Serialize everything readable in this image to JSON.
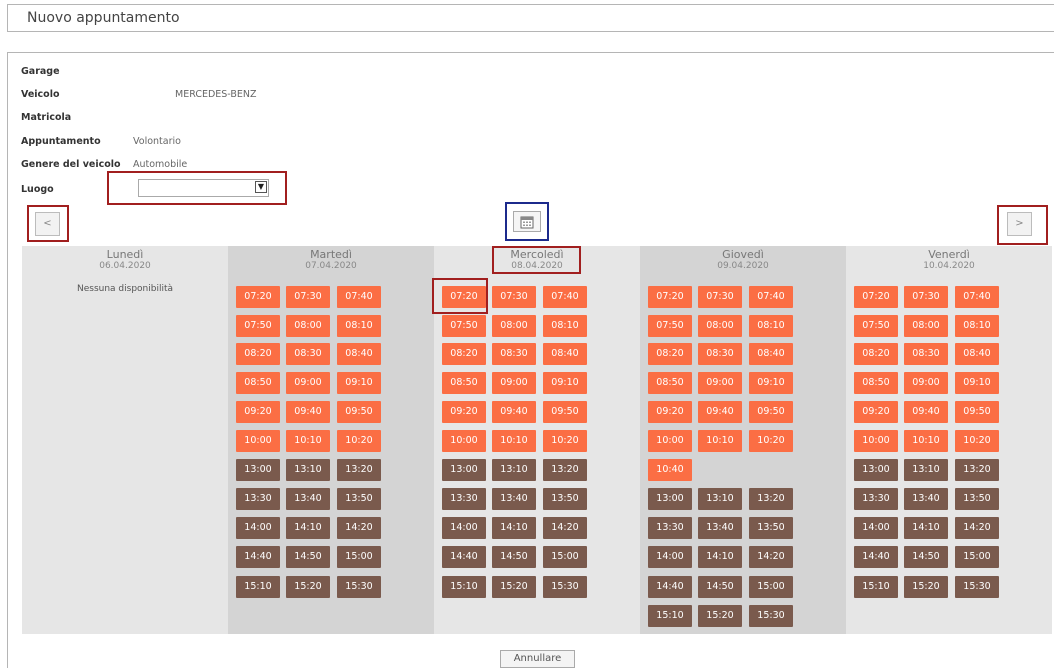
{
  "title": "Nuovo appuntamento",
  "form": {
    "garage_label": "Garage",
    "veicolo_label": "Veicolo",
    "veicolo_value": "MERCEDES-BENZ",
    "matricola_label": "Matricola",
    "appuntamento_label": "Appuntamento",
    "appuntamento_value": "Volontario",
    "genere_label": "Genere del veicolo",
    "genere_value": "Automobile",
    "luogo_label": "Luogo",
    "luogo_value": ""
  },
  "nav": {
    "prev": "<",
    "next": ">",
    "calendar_icon": "calendar-icon"
  },
  "colors": {
    "available": "#fb6e44",
    "available_alt": "#7a5a4d",
    "highlight_red": "#a11f1f",
    "highlight_blue": "#1c2a8c"
  },
  "days": [
    {
      "name": "Lunedì",
      "date": "06.04.2020",
      "no_availability": "Nessuna disponibilità",
      "rows": []
    },
    {
      "name": "Martedì",
      "date": "07.04.2020",
      "rows": [
        {
          "t": [
            "07:20",
            "07:30",
            "07:40"
          ],
          "c": "o"
        },
        {
          "t": [
            "07:50",
            "08:00",
            "08:10"
          ],
          "c": "o"
        },
        {
          "t": [
            "08:20",
            "08:30",
            "08:40"
          ],
          "c": "o"
        },
        {
          "t": [
            "08:50",
            "09:00",
            "09:10"
          ],
          "c": "o"
        },
        {
          "t": [
            "09:20",
            "09:40",
            "09:50"
          ],
          "c": "o"
        },
        {
          "t": [
            "10:00",
            "10:10",
            "10:20"
          ],
          "c": "o"
        },
        {
          "t": [
            "13:00",
            "13:10",
            "13:20"
          ],
          "c": "b"
        },
        {
          "t": [
            "13:30",
            "13:40",
            "13:50"
          ],
          "c": "b"
        },
        {
          "t": [
            "14:00",
            "14:10",
            "14:20"
          ],
          "c": "b"
        },
        {
          "t": [
            "14:40",
            "14:50",
            "15:00"
          ],
          "c": "b"
        },
        {
          "t": [
            "15:10",
            "15:20",
            "15:30"
          ],
          "c": "b"
        }
      ]
    },
    {
      "name": "Mercoledì",
      "date": "08.04.2020",
      "rows": [
        {
          "t": [
            "07:20",
            "07:30",
            "07:40"
          ],
          "c": "o"
        },
        {
          "t": [
            "07:50",
            "08:00",
            "08:10"
          ],
          "c": "o"
        },
        {
          "t": [
            "08:20",
            "08:30",
            "08:40"
          ],
          "c": "o"
        },
        {
          "t": [
            "08:50",
            "09:00",
            "09:10"
          ],
          "c": "o"
        },
        {
          "t": [
            "09:20",
            "09:40",
            "09:50"
          ],
          "c": "o"
        },
        {
          "t": [
            "10:00",
            "10:10",
            "10:20"
          ],
          "c": "o"
        },
        {
          "t": [
            "13:00",
            "13:10",
            "13:20"
          ],
          "c": "b"
        },
        {
          "t": [
            "13:30",
            "13:40",
            "13:50"
          ],
          "c": "b"
        },
        {
          "t": [
            "14:00",
            "14:10",
            "14:20"
          ],
          "c": "b"
        },
        {
          "t": [
            "14:40",
            "14:50",
            "15:00"
          ],
          "c": "b"
        },
        {
          "t": [
            "15:10",
            "15:20",
            "15:30"
          ],
          "c": "b"
        }
      ]
    },
    {
      "name": "Giovedì",
      "date": "09.04.2020",
      "rows": [
        {
          "t": [
            "07:20",
            "07:30",
            "07:40"
          ],
          "c": "o"
        },
        {
          "t": [
            "07:50",
            "08:00",
            "08:10"
          ],
          "c": "o"
        },
        {
          "t": [
            "08:20",
            "08:30",
            "08:40"
          ],
          "c": "o"
        },
        {
          "t": [
            "08:50",
            "09:00",
            "09:10"
          ],
          "c": "o"
        },
        {
          "t": [
            "09:20",
            "09:40",
            "09:50"
          ],
          "c": "o"
        },
        {
          "t": [
            "10:00",
            "10:10",
            "10:20"
          ],
          "c": "o"
        },
        {
          "t": [
            "10:40"
          ],
          "c": "o"
        },
        {
          "t": [
            "13:00",
            "13:10",
            "13:20"
          ],
          "c": "b"
        },
        {
          "t": [
            "13:30",
            "13:40",
            "13:50"
          ],
          "c": "b"
        },
        {
          "t": [
            "14:00",
            "14:10",
            "14:20"
          ],
          "c": "b"
        },
        {
          "t": [
            "14:40",
            "14:50",
            "15:00"
          ],
          "c": "b"
        },
        {
          "t": [
            "15:10",
            "15:20",
            "15:30"
          ],
          "c": "b"
        }
      ]
    },
    {
      "name": "Venerdì",
      "date": "10.04.2020",
      "rows": [
        {
          "t": [
            "07:20",
            "07:30",
            "07:40"
          ],
          "c": "o"
        },
        {
          "t": [
            "07:50",
            "08:00",
            "08:10"
          ],
          "c": "o"
        },
        {
          "t": [
            "08:20",
            "08:30",
            "08:40"
          ],
          "c": "o"
        },
        {
          "t": [
            "08:50",
            "09:00",
            "09:10"
          ],
          "c": "o"
        },
        {
          "t": [
            "09:20",
            "09:40",
            "09:50"
          ],
          "c": "o"
        },
        {
          "t": [
            "10:00",
            "10:10",
            "10:20"
          ],
          "c": "o"
        },
        {
          "t": [
            "13:00",
            "13:10",
            "13:20"
          ],
          "c": "b"
        },
        {
          "t": [
            "13:30",
            "13:40",
            "13:50"
          ],
          "c": "b"
        },
        {
          "t": [
            "14:00",
            "14:10",
            "14:20"
          ],
          "c": "b"
        },
        {
          "t": [
            "14:40",
            "14:50",
            "15:00"
          ],
          "c": "b"
        },
        {
          "t": [
            "15:10",
            "15:20",
            "15:30"
          ],
          "c": "b"
        }
      ]
    }
  ],
  "cancel_label": "Annullare"
}
